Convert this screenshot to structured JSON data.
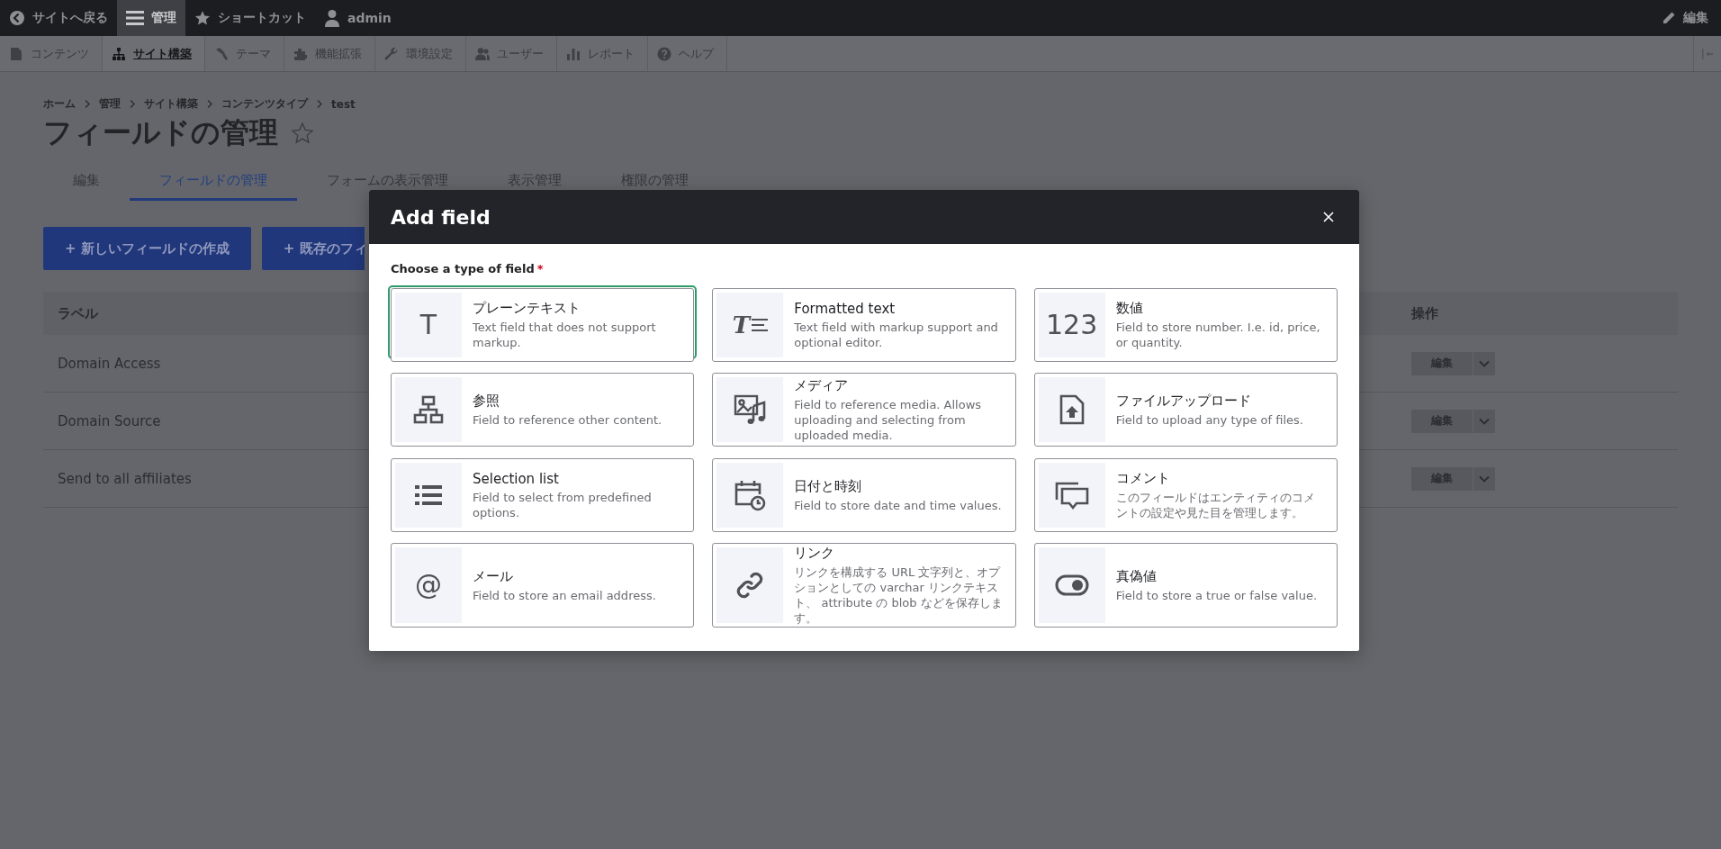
{
  "toolbar": {
    "items": [
      {
        "label": "サイトへ戻る",
        "selected": false
      },
      {
        "label": "管理",
        "selected": true
      },
      {
        "label": "ショートカット",
        "selected": false
      },
      {
        "label": "admin",
        "selected": false
      }
    ],
    "edit": "編集"
  },
  "admin_menu": [
    {
      "label": "コンテンツ",
      "selected": false
    },
    {
      "label": "サイト構築",
      "selected": true
    },
    {
      "label": "テーマ",
      "selected": false
    },
    {
      "label": "機能拡張",
      "selected": false
    },
    {
      "label": "環境設定",
      "selected": false
    },
    {
      "label": "ユーザー",
      "selected": false
    },
    {
      "label": "レポート",
      "selected": false
    },
    {
      "label": "ヘルプ",
      "selected": false
    }
  ],
  "breadcrumb": [
    "ホーム",
    "管理",
    "サイト構築",
    "コンテンツタイプ",
    "test"
  ],
  "page_title": "フィールドの管理",
  "tabs": [
    {
      "label": "編集",
      "selected": false
    },
    {
      "label": "フィールドの管理",
      "selected": true
    },
    {
      "label": "フォームの表示管理",
      "selected": false
    },
    {
      "label": "表示管理",
      "selected": false
    },
    {
      "label": "権限の管理",
      "selected": false
    }
  ],
  "actions": [
    "+ 新しいフィールドの作成",
    "+ 既存のフィ"
  ],
  "table": {
    "columns": [
      "ラベル",
      "操作"
    ],
    "rows": [
      {
        "label": "Domain Access",
        "operation": "編集"
      },
      {
        "label": "Domain Source",
        "operation": "編集"
      },
      {
        "label": "Send to all affiliates",
        "operation": "編集"
      }
    ]
  },
  "dialog": {
    "title": "Add field",
    "field_label": "Choose a type of field",
    "required_mark": "*",
    "cards": [
      {
        "kind": "glyph",
        "glyph": "T",
        "title": "プレーンテキスト",
        "description": "Text field that does not support markup.",
        "selected": true
      },
      {
        "kind": "formatted",
        "glyph": "T",
        "title": "Formatted text",
        "description": "Text field with markup support and optional editor.",
        "selected": false
      },
      {
        "kind": "glyph",
        "glyph": "123",
        "title": "数値",
        "description": "Field to store number. I.e. id, price, or quantity.",
        "selected": false
      },
      {
        "kind": "reference",
        "title": "参照",
        "description": "Field to reference other content.",
        "selected": false
      },
      {
        "kind": "media",
        "title": "メディア",
        "description": "Field to reference media. Allows uploading and selecting from uploaded media.",
        "selected": false
      },
      {
        "kind": "file",
        "title": "ファイルアップロード",
        "description": "Field to upload any type of files.",
        "selected": false
      },
      {
        "kind": "list",
        "title": "Selection list",
        "description": "Field to select from predefined options.",
        "selected": false
      },
      {
        "kind": "datetime",
        "title": "日付と時刻",
        "description": "Field to store date and time values.",
        "selected": false
      },
      {
        "kind": "comment",
        "title": "コメント",
        "description": "このフィールドはエンティティのコメントの設定や見た目を管理します。",
        "selected": false
      },
      {
        "kind": "glyph",
        "glyph": "@",
        "title": "メール",
        "description": "Field to store an email address.",
        "selected": false
      },
      {
        "kind": "link",
        "title": "リンク",
        "description": "リンクを構成する URL 文字列と、オプションとしての varchar リンクテキスト、 attribute の blob などを保存します。",
        "selected": false
      },
      {
        "kind": "boolean",
        "title": "真偽値",
        "description": "Field to store a true or false value.",
        "selected": false
      }
    ]
  }
}
